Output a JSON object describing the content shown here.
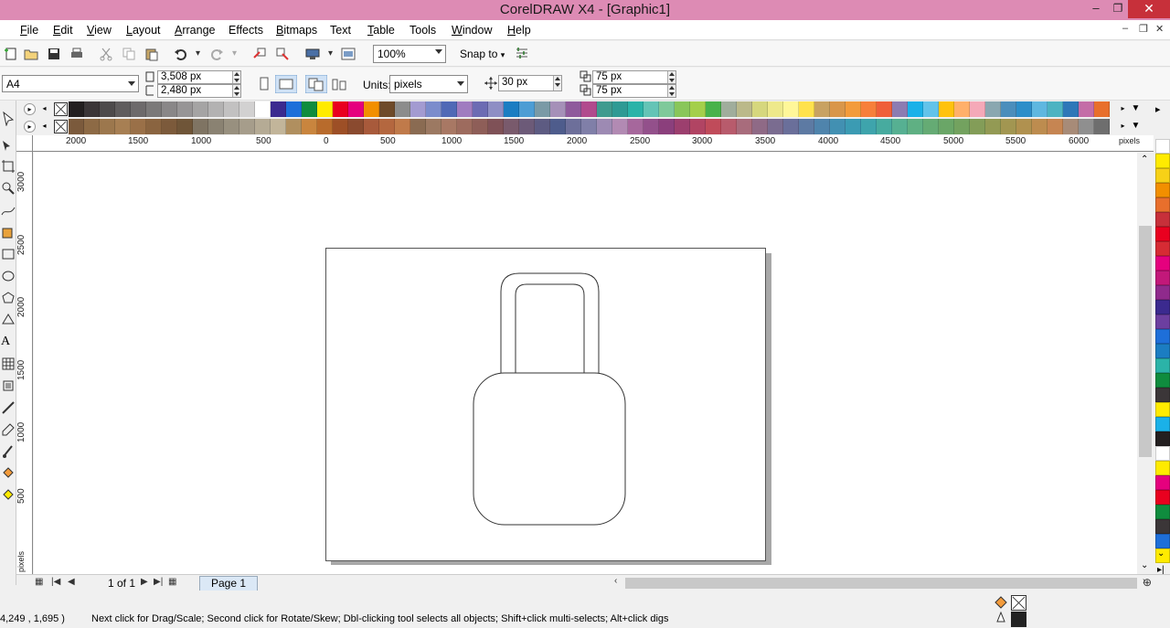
{
  "window": {
    "title": "CorelDRAW X4 - [Graphic1]",
    "min_label": "–",
    "max_label": "❐",
    "close_label": "✕"
  },
  "menu": {
    "items": [
      "File",
      "Edit",
      "View",
      "Layout",
      "Arrange",
      "Effects",
      "Bitmaps",
      "Text",
      "Table",
      "Tools",
      "Window",
      "Help"
    ]
  },
  "toolbar": {
    "zoom_value": "100%",
    "snap_label": "Snap to"
  },
  "property_bar": {
    "page_size": "A4",
    "width": "3,508 px",
    "height": "2,480 px",
    "units_label": "Units:",
    "units_value": "pixels",
    "nudge": "30 px",
    "dup_x": "75 px",
    "dup_y": "75 px"
  },
  "rulers": {
    "h_labels": [
      "2000",
      "1500",
      "1000",
      "500",
      "0",
      "500",
      "1000",
      "1500",
      "2000",
      "2500",
      "3000",
      "3500",
      "4000",
      "4500",
      "5000",
      "5500",
      "6000"
    ],
    "h_unit": "pixels",
    "v_labels": [
      "3000",
      "2500",
      "2000",
      "1500",
      "1000",
      "500"
    ],
    "v_unit": "pixels"
  },
  "page_nav": {
    "count": "1 of 1",
    "tab_label": "Page 1"
  },
  "status": {
    "coords": "4,249 , 1,695 )",
    "message": "Next click for Drag/Scale; Second click for Rotate/Skew; Dbl-clicking tool selects all objects; Shift+click multi-selects; Alt+click digs"
  },
  "palette_row1": [
    "#231f20",
    "#3b3638",
    "#4d4a4b",
    "#5f5c5d",
    "#6d6a6b",
    "#7b7979",
    "#898788",
    "#979596",
    "#a5a4a4",
    "#b3b2b2",
    "#c2c1c1",
    "#d2d1d1",
    "#ffffff",
    "#3b2a8f",
    "#1e6fd9",
    "#0f8c3e",
    "#ffeb00",
    "#e9001f",
    "#e5007e",
    "#f28f00",
    "#6e4a2a",
    "#8c8c8c",
    "#a39bd1",
    "#7b8ccc",
    "#5069b6",
    "#a07cc0",
    "#6c6bb3",
    "#8e8ec4",
    "#1b7dc2",
    "#4d9dd4",
    "#7a9aa6",
    "#a590b8",
    "#8f5a9c",
    "#b14a8d",
    "#3f9b8f",
    "#2f9a94",
    "#2bb3a8",
    "#64c4b6",
    "#7fc99a",
    "#89c65a",
    "#a4cf4a",
    "#48b24a",
    "#a0ad9c",
    "#bbb98a",
    "#d6d77d",
    "#eee98b",
    "#fff799",
    "#ffe24d",
    "#c8a262",
    "#d9964a",
    "#f39b3b",
    "#f77f3a",
    "#ef5f3a",
    "#8c7cb2",
    "#1ab1e8",
    "#62c3ea",
    "#ffc20e",
    "#ffb06a",
    "#f5a9b8",
    "#8aa7b0",
    "#4b8ebc",
    "#2d8ec9",
    "#5fb7e0",
    "#4db3c2",
    "#2e77b8",
    "#c46da7",
    "#e86f2c"
  ],
  "palette_row2": [
    "#7b5a3c",
    "#8d6a45",
    "#9c774d",
    "#a77f53",
    "#9a7048",
    "#8a6440",
    "#7c5a3b",
    "#6f5538",
    "#7f7463",
    "#8a8272",
    "#98907f",
    "#a69d8b",
    "#b5ab95",
    "#c2b59a",
    "#b08f5f",
    "#c9853e",
    "#b86b2c",
    "#9d4f26",
    "#8a4a2f",
    "#a85a3b",
    "#b4673f",
    "#c07a4a",
    "#8a6b52",
    "#9c7962",
    "#a87864",
    "#9d6b5e",
    "#8e5e58",
    "#7f5157",
    "#795a6c",
    "#6c5a78",
    "#5d5b82",
    "#4e5c8c",
    "#6d6f9a",
    "#807fa8",
    "#9d8ab3",
    "#b28ab3",
    "#a6679c",
    "#93508b",
    "#8b3f7c",
    "#9c3f6e",
    "#b14463",
    "#c04b5a",
    "#b85b6c",
    "#a86c7c",
    "#8f6a86",
    "#7a6c90",
    "#6a6f9a",
    "#5d7aa3",
    "#4f84ac",
    "#4290b2",
    "#3b9bb3",
    "#3ea4ac",
    "#47ab9f",
    "#56b092",
    "#5fb083",
    "#65ab74",
    "#6aa667",
    "#73a25f",
    "#839d58",
    "#939a54",
    "#a29651",
    "#b0914f",
    "#bd8c4f",
    "#c68552",
    "#a78b78",
    "#8f8f8f",
    "#6e6e6e"
  ],
  "right_palette": [
    "#ffffff",
    "#ffeb00",
    "#f7d117",
    "#f28f00",
    "#e86f2c",
    "#c7303a",
    "#e9001f",
    "#d62b34",
    "#e5007e",
    "#c2187a",
    "#8f2a8c",
    "#3b2a8f",
    "#6c3fa0",
    "#1e6fd9",
    "#1b7dc2",
    "#2bb3a8",
    "#0f8c3e",
    "#3b3638",
    "#ffeb00",
    "#1ab1e8",
    "#231f20",
    "#ffffff",
    "#ffeb00",
    "#e5007e",
    "#e9001f",
    "#0f8c3e",
    "#3b3638",
    "#1e6fd9",
    "#ffeb00"
  ],
  "drawing": {
    "stroke_color": "#333333"
  }
}
